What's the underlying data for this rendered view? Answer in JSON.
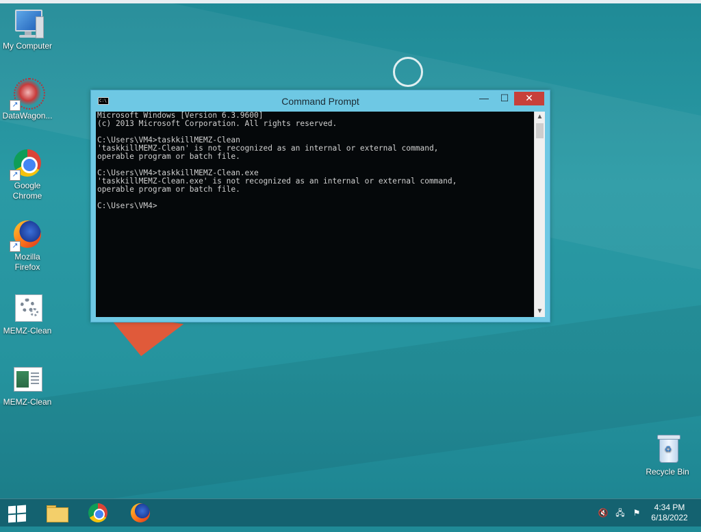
{
  "desktop": {
    "icons": [
      {
        "label": "My Computer"
      },
      {
        "label": "DataWagon..."
      },
      {
        "label": "Google Chrome"
      },
      {
        "label": "Mozilla Firefox"
      },
      {
        "label": "MEMZ-Clean"
      },
      {
        "label": "MEMZ-Clean"
      },
      {
        "label": "Recycle Bin"
      }
    ]
  },
  "window": {
    "title": "Command Prompt",
    "app_icon_text": "C:\\",
    "minimize_glyph": "—",
    "maximize_glyph": "☐",
    "close_glyph": "✕",
    "console_lines": [
      "Microsoft Windows [Version 6.3.9600]",
      "(c) 2013 Microsoft Corporation. All rights reserved.",
      "",
      "C:\\Users\\VM4>taskkillMEMZ-Clean",
      "'taskkillMEMZ-Clean' is not recognized as an internal or external command,",
      "operable program or batch file.",
      "",
      "C:\\Users\\VM4>taskkillMEMZ-Clean.exe",
      "'taskkillMEMZ-Clean.exe' is not recognized as an internal or external command,",
      "operable program or batch file.",
      "",
      "C:\\Users\\VM4>"
    ],
    "scroll_up_glyph": "▲",
    "scroll_down_glyph": "▼"
  },
  "taskbar": {
    "tray": {
      "volume_icon": "🔇",
      "network_icon": "🖧",
      "flag_icon": "⚑"
    },
    "clock": {
      "time": "4:34 PM",
      "date": "6/18/2022"
    }
  },
  "colors": {
    "desktop_bg": "#2a9aa5",
    "window_frame": "#6ec8e4",
    "close_button": "#c7403a",
    "console_bg": "#05080a"
  }
}
